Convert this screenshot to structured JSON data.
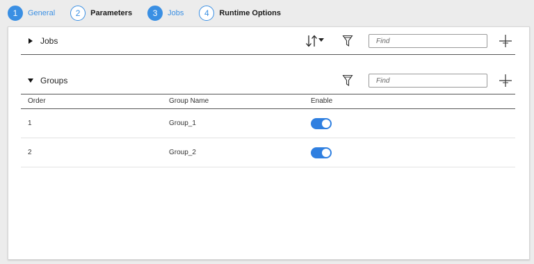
{
  "stepper": {
    "steps": [
      {
        "number": "1",
        "label": "General",
        "state": "active"
      },
      {
        "number": "2",
        "label": "Parameters",
        "state": "inactive"
      },
      {
        "number": "3",
        "label": "Jobs",
        "state": "active"
      },
      {
        "number": "4",
        "label": "Runtime Options",
        "state": "inactive"
      }
    ]
  },
  "jobs_section": {
    "title": "Jobs",
    "expanded": false,
    "find_placeholder": "Find",
    "icons": {
      "sort": "sort-icon",
      "filter": "filter-icon",
      "add": "add-icon"
    }
  },
  "groups_section": {
    "title": "Groups",
    "expanded": true,
    "find_placeholder": "Find",
    "icons": {
      "filter": "filter-icon",
      "add": "add-icon"
    },
    "table": {
      "headers": {
        "order": "Order",
        "name": "Group Name",
        "enable": "Enable"
      },
      "rows": [
        {
          "order": "1",
          "name": "Group_1",
          "enabled": true
        },
        {
          "order": "2",
          "name": "Group_2",
          "enabled": true
        }
      ]
    }
  },
  "colors": {
    "accent": "#3a8fe3",
    "toggle_on": "#2f7fe0"
  }
}
